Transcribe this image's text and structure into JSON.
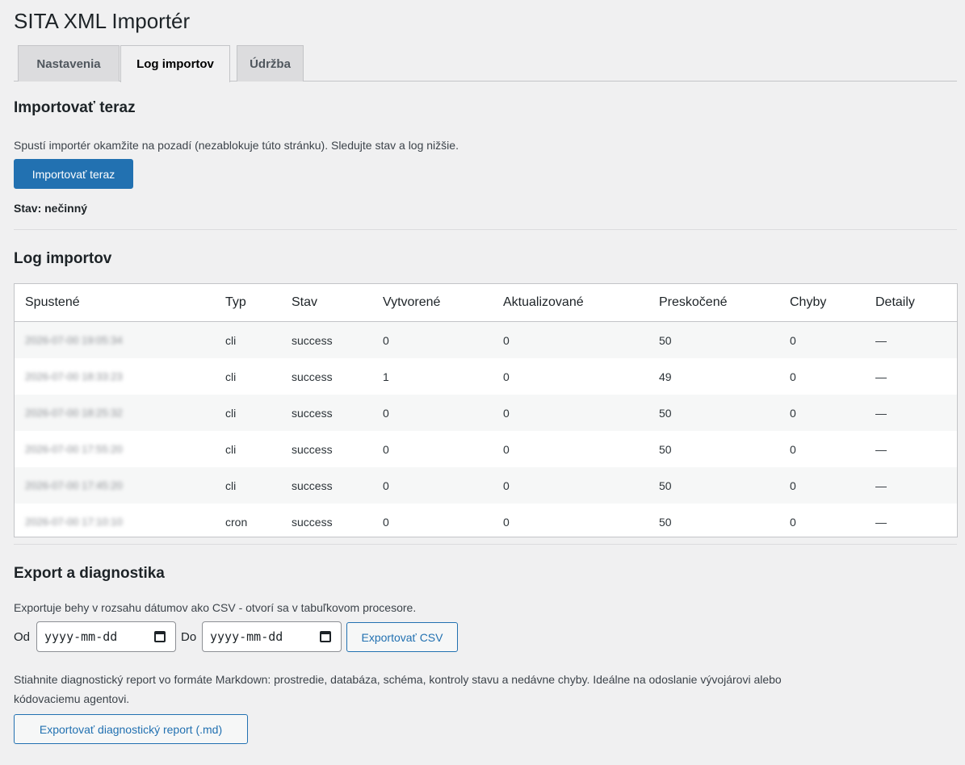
{
  "page_title": "SITA XML Importér",
  "tabs": [
    "Nastavenia",
    "Log importov",
    "Údržba"
  ],
  "import_now": {
    "heading": "Importovať teraz",
    "description": "Spustí importér okamžite na pozadí (nezablokuje túto stránku). Sledujte stav a log nižšie.",
    "button": "Importovať teraz",
    "status": "Stav: nečinný"
  },
  "log": {
    "heading": "Log importov",
    "columns": [
      "Spustené",
      "Typ",
      "Stav",
      "Vytvorené",
      "Aktualizované",
      "Preskočené",
      "Chyby",
      "Detaily"
    ],
    "rows": [
      {
        "started": "2026-07-00 19:05:34",
        "type": "cli",
        "status": "success",
        "created": "0",
        "updated": "0",
        "skipped": "50",
        "errors": "0",
        "details": "—"
      },
      {
        "started": "2026-07-00 18:33:23",
        "type": "cli",
        "status": "success",
        "created": "1",
        "updated": "0",
        "skipped": "49",
        "errors": "0",
        "details": "—"
      },
      {
        "started": "2026-07-00 18:25:32",
        "type": "cli",
        "status": "success",
        "created": "0",
        "updated": "0",
        "skipped": "50",
        "errors": "0",
        "details": "—"
      },
      {
        "started": "2026-07-00 17:55:20",
        "type": "cli",
        "status": "success",
        "created": "0",
        "updated": "0",
        "skipped": "50",
        "errors": "0",
        "details": "—"
      },
      {
        "started": "2026-07-00 17:45:20",
        "type": "cli",
        "status": "success",
        "created": "0",
        "updated": "0",
        "skipped": "50",
        "errors": "0",
        "details": "—"
      },
      {
        "started": "2026-07-00 17:10:10",
        "type": "cron",
        "status": "success",
        "created": "0",
        "updated": "0",
        "skipped": "50",
        "errors": "0",
        "details": "—"
      }
    ]
  },
  "export": {
    "heading": "Export a diagnostika",
    "csv_description": "Exportuje behy v rozsahu dátumov ako CSV - otvorí sa v tabuľkovom procesore.",
    "from_label": "Od",
    "to_label": "Do",
    "date_placeholder": "yyyy-mm-dd",
    "csv_button": "Exportovať CSV",
    "diag_description_1": "Stiahnite diagnostický report vo formáte Markdown: prostredie, databáza, schéma, kontroly stavu a nedávne chyby. Ideálne na odoslanie vývojárovi alebo",
    "diag_description_2": "kódovaciemu agentovi.",
    "diag_button": "Exportovať diagnostický report (.md)"
  },
  "colors": {
    "primary": "#2271b1",
    "background": "#f0f0f1"
  },
  "icons": [
    "calendar-icon"
  ]
}
